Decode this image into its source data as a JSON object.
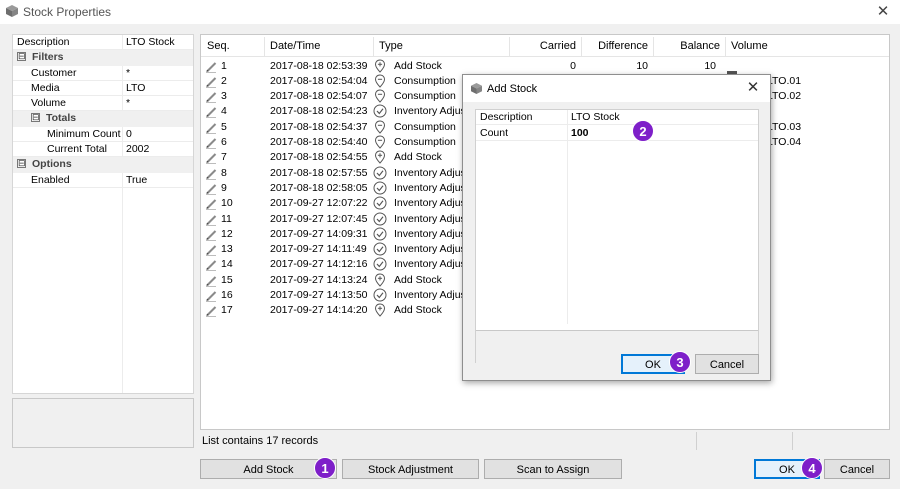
{
  "window": {
    "title": "Stock Properties",
    "close_glyph": "✕"
  },
  "properties": {
    "rows": [
      {
        "kind": "prop",
        "name": "Description",
        "value": "LTO Stock",
        "indent": 0
      },
      {
        "kind": "cat",
        "name": "Filters",
        "toggle": "⊟",
        "indent": 0
      },
      {
        "kind": "prop",
        "name": "Customer",
        "value": "*",
        "indent": 1
      },
      {
        "kind": "prop",
        "name": "Media",
        "value": "LTO",
        "indent": 1
      },
      {
        "kind": "prop",
        "name": "Volume",
        "value": "*",
        "indent": 1
      },
      {
        "kind": "cat",
        "name": "Totals",
        "toggle": "⊟",
        "indent": 1
      },
      {
        "kind": "prop",
        "name": "Minimum Count",
        "value": "0",
        "indent": 2
      },
      {
        "kind": "prop",
        "name": "Current Total",
        "value": "2002",
        "indent": 2
      },
      {
        "kind": "cat",
        "name": "Options",
        "toggle": "⊟",
        "indent": 0
      },
      {
        "kind": "prop",
        "name": "Enabled",
        "value": "True",
        "indent": 1
      }
    ]
  },
  "list": {
    "columns": {
      "seq": "Seq.",
      "datetime": "Date/Time",
      "type": "Type",
      "carried": "Carried",
      "difference": "Difference",
      "balance": "Balance",
      "volume": "Volume"
    },
    "rows": [
      {
        "seq": "1",
        "datetime": "2017-08-18 02:53:39",
        "type": "Add Stock",
        "icon": "add-stock-icon",
        "carried": "0",
        "difference": "10",
        "balance": "10",
        "volume": ""
      },
      {
        "seq": "2",
        "datetime": "2017-08-18 02:54:04",
        "type": "Consumption",
        "icon": "consumption-icon",
        "carried": "",
        "difference": "",
        "balance": "",
        "volume": "LTO.01"
      },
      {
        "seq": "3",
        "datetime": "2017-08-18 02:54:07",
        "type": "Consumption",
        "icon": "consumption-icon",
        "carried": "",
        "difference": "",
        "balance": "",
        "volume": "LTO.02"
      },
      {
        "seq": "4",
        "datetime": "2017-08-18 02:54:23",
        "type": "Inventory Adjus",
        "icon": "inventory-adjust-icon",
        "carried": "",
        "difference": "",
        "balance": "",
        "volume": ""
      },
      {
        "seq": "5",
        "datetime": "2017-08-18 02:54:37",
        "type": "Consumption",
        "icon": "consumption-icon",
        "carried": "",
        "difference": "",
        "balance": "",
        "volume": "LTO.03"
      },
      {
        "seq": "6",
        "datetime": "2017-08-18 02:54:40",
        "type": "Consumption",
        "icon": "consumption-icon",
        "carried": "",
        "difference": "",
        "balance": "",
        "volume": "LTO.04"
      },
      {
        "seq": "7",
        "datetime": "2017-08-18 02:54:55",
        "type": "Add Stock",
        "icon": "add-stock-icon",
        "carried": "",
        "difference": "",
        "balance": "",
        "volume": ""
      },
      {
        "seq": "8",
        "datetime": "2017-08-18 02:57:55",
        "type": "Inventory Adjus",
        "icon": "inventory-adjust-icon",
        "carried": "",
        "difference": "",
        "balance": "",
        "volume": ""
      },
      {
        "seq": "9",
        "datetime": "2017-08-18 02:58:05",
        "type": "Inventory Adjus",
        "icon": "inventory-adjust-icon",
        "carried": "",
        "difference": "",
        "balance": "",
        "volume": ""
      },
      {
        "seq": "10",
        "datetime": "2017-09-27 12:07:22",
        "type": "Inventory Adjus",
        "icon": "inventory-adjust-icon",
        "carried": "",
        "difference": "",
        "balance": "",
        "volume": ""
      },
      {
        "seq": "11",
        "datetime": "2017-09-27 12:07:45",
        "type": "Inventory Adjus",
        "icon": "inventory-adjust-icon",
        "carried": "",
        "difference": "",
        "balance": "",
        "volume": ""
      },
      {
        "seq": "12",
        "datetime": "2017-09-27 14:09:31",
        "type": "Inventory Adjus",
        "icon": "inventory-adjust-icon",
        "carried": "",
        "difference": "",
        "balance": "",
        "volume": ""
      },
      {
        "seq": "13",
        "datetime": "2017-09-27 14:11:49",
        "type": "Inventory Adjus",
        "icon": "inventory-adjust-icon",
        "carried": "",
        "difference": "",
        "balance": "",
        "volume": ""
      },
      {
        "seq": "14",
        "datetime": "2017-09-27 14:12:16",
        "type": "Inventory Adjus",
        "icon": "inventory-adjust-icon",
        "carried": "",
        "difference": "",
        "balance": "",
        "volume": ""
      },
      {
        "seq": "15",
        "datetime": "2017-09-27 14:13:24",
        "type": "Add Stock",
        "icon": "add-stock-icon",
        "carried": "",
        "difference": "",
        "balance": "",
        "volume": ""
      },
      {
        "seq": "16",
        "datetime": "2017-09-27 14:13:50",
        "type": "Inventory Adjus",
        "icon": "inventory-adjust-icon",
        "carried": "",
        "difference": "",
        "balance": "",
        "volume": ""
      },
      {
        "seq": "17",
        "datetime": "2017-09-27 14:14:20",
        "type": "Add Stock",
        "icon": "add-stock-icon",
        "carried": "",
        "difference": "",
        "balance": "",
        "volume": ""
      }
    ],
    "status": "List contains 17 records"
  },
  "buttons": {
    "add_stock": "Add Stock",
    "stock_adjustment": "Stock Adjustment",
    "scan_to_assign": "Scan to Assign",
    "ok": "OK",
    "cancel": "Cancel"
  },
  "dialog": {
    "title": "Add Stock",
    "close_glyph": "✕",
    "rows": [
      {
        "name": "Description",
        "value": "LTO Stock",
        "bold": false
      },
      {
        "name": "Count",
        "value": "100",
        "bold": true
      }
    ],
    "ok": "OK",
    "cancel": "Cancel"
  },
  "callouts": {
    "c1": "1",
    "c2": "2",
    "c3": "3",
    "c4": "4"
  },
  "colors": {
    "callout": "#7e1fc9",
    "default_button_border": "#0078d7"
  }
}
